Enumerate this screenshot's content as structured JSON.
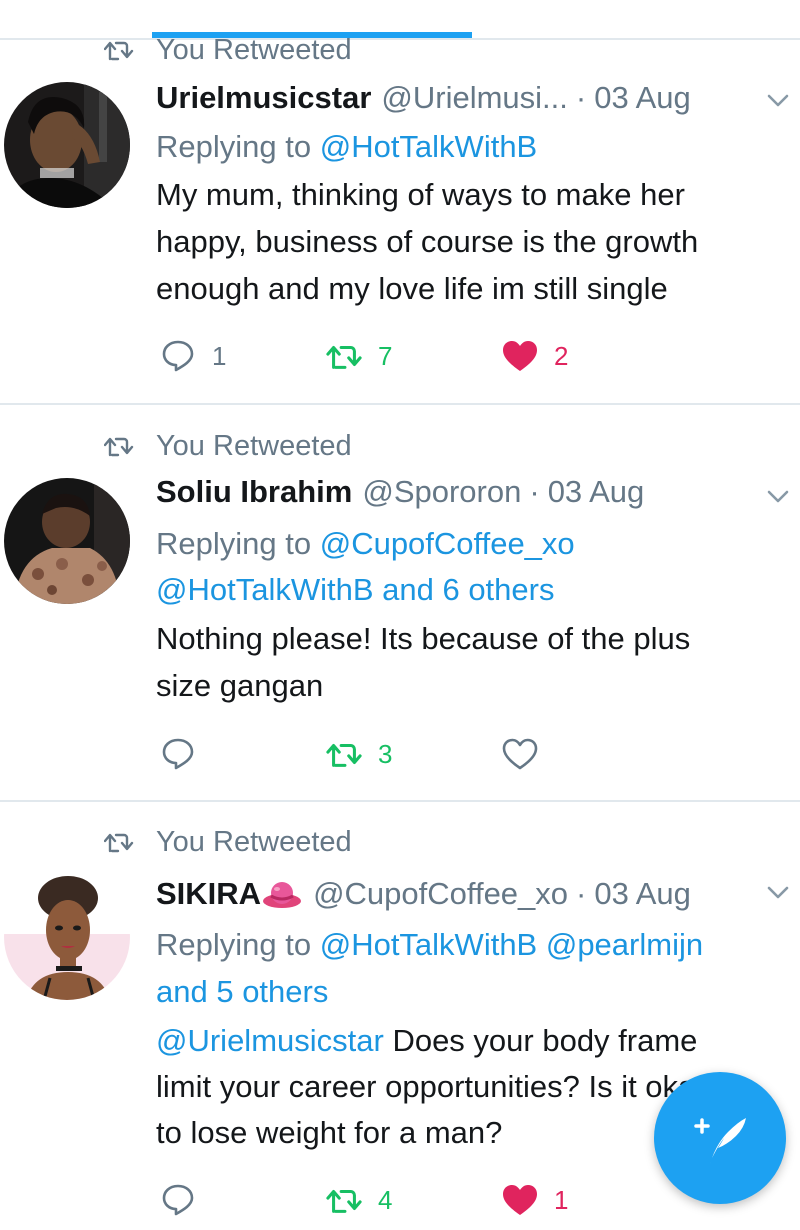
{
  "colors": {
    "accent": "#1da1f2",
    "link": "#1b95e0",
    "retweet_green": "#17bf63",
    "like_red": "#e0245e",
    "muted": "#657786"
  },
  "tweets": [
    {
      "retweeted_label": "You Retweeted",
      "name": "Urielmusicstar",
      "handle": "@Urielmusi...",
      "dot": "·",
      "date": "03 Aug",
      "replying_prefix": "Replying to",
      "replying_line1": "@HotTalkWithB",
      "body_lines": [
        "My mum, thinking of ways to make her",
        "happy, business of course is the growth",
        "enough and my love life im still single"
      ],
      "reply_count": "1",
      "retweet_count": "7",
      "like_count": "2",
      "retweeted": true,
      "liked": true
    },
    {
      "retweeted_label": "You Retweeted",
      "name": "Soliu Ibrahim",
      "handle": "@Spororon",
      "dot": "·",
      "date": "03 Aug",
      "replying_prefix": "Replying to",
      "replying_line1": "@CupofCoffee_xo",
      "replying_line2": "@HotTalkWithB and 6 others",
      "body_lines": [
        "Nothing please! Its because of the plus",
        "size gangan"
      ],
      "reply_count": "",
      "retweet_count": "3",
      "like_count": "",
      "retweeted": true,
      "liked": false
    },
    {
      "retweeted_label": "You Retweeted",
      "name": "SIKIRA",
      "handle": "@CupofCoffee_xo",
      "dot": "·",
      "date": "03 Aug",
      "replying_prefix": "Replying to",
      "replying_line1": "@HotTalkWithB @pearlmijn",
      "replying_line2": "and 5 others",
      "body_mention": "@Urielmusicstar",
      "body_line1_rest": " Does your body frame",
      "body_lines": [
        "limit your career opportunities? Is it okay",
        "to lose weight for a man?"
      ],
      "reply_count": "",
      "retweet_count": "4",
      "like_count": "1",
      "retweeted": true,
      "liked": true
    }
  ],
  "icons": {
    "retweet": "retweet-icon",
    "reply": "reply-icon",
    "like": "heart-icon",
    "chevron": "chevron-down-icon",
    "compose": "compose-tweet-icon",
    "hat": "hat-emoji-icon"
  }
}
